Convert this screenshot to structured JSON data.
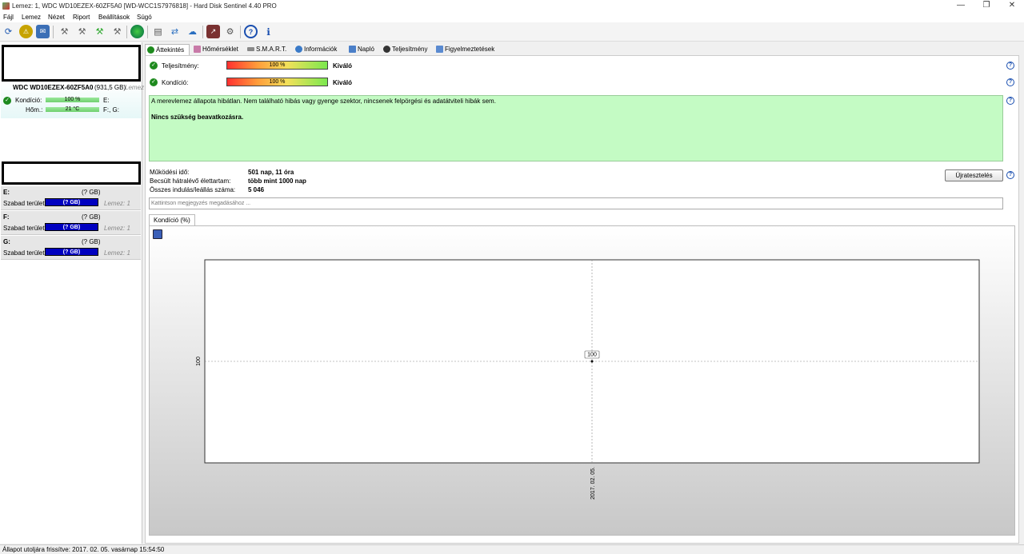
{
  "window": {
    "title": "Lemez: 1, WDC WD10EZEX-60ZF5A0 [WD-WCC1S7976818]  -  Hard Disk Sentinel 4.40 PRO"
  },
  "menu": [
    "Fájl",
    "Lemez",
    "Nézet",
    "Riport",
    "Beállítások",
    "Súgó"
  ],
  "toolbar_icons": [
    "refresh-icon",
    "disk-check-icon",
    "mail-icon",
    "tool-icon",
    "tool-icon",
    "tool-icon",
    "tool-icon",
    "globe-icon",
    "document-icon",
    "sync-icon",
    "network-icon",
    "chart-icon",
    "settings-icon",
    "help-icon",
    "info-icon"
  ],
  "left": {
    "disk_name": "WDC WD10EZEX-60ZF5A0",
    "disk_size": "(931,5 GB)",
    "disk_suffix": "Lemez",
    "condition_label": "Kondíció:",
    "condition_value": "100 %",
    "condition_drives": "E:",
    "temp_label": "Hőm.:",
    "temp_value": "21 °C",
    "temp_drives": "F:, G:",
    "volumes": [
      {
        "letter": "E:",
        "size": "(? GB)",
        "free_label": "Szabad terület",
        "free": "(? GB)",
        "disk": "Lemez: 1"
      },
      {
        "letter": "F:",
        "size": "(? GB)",
        "free_label": "Szabad terület",
        "free": "(? GB)",
        "disk": "Lemez: 1"
      },
      {
        "letter": "G:",
        "size": "(? GB)",
        "free_label": "Szabad terület",
        "free": "(? GB)",
        "disk": "Lemez: 1"
      }
    ]
  },
  "tabs": [
    "Áttekintés",
    "Hőmérséklet",
    "S.M.A.R.T.",
    "Információk",
    "Napló",
    "Teljesítmény",
    "Figyelmeztetések"
  ],
  "overview": {
    "performance_label": "Teljesítmény:",
    "performance_value": "100 %",
    "performance_rating": "Kiváló",
    "health_label": "Kondíció:",
    "health_value": "100 %",
    "health_rating": "Kiváló",
    "message": "A merevlemez állapota hibátlan. Nem található hibás vagy gyenge szektor, nincsenek felpörgési és adatátviteli hibák sem.",
    "recommendation": "Nincs szükség beavatkozásra.",
    "uptime_label": "Működési idő:",
    "uptime_value": "501 nap, 11 óra",
    "lifetime_label": "Becsült hátralévő élettartam:",
    "lifetime_value": "több mint 1000 nap",
    "startstop_label": "Összes indulás/leállás száma:",
    "startstop_value": "5 046",
    "retest_button": "Újratesztelés",
    "note_placeholder": "Kattintson megjegyzés megadásához ...",
    "chart_tab": "Kondíció  (%)"
  },
  "chart_data": {
    "type": "line",
    "x": [
      "2017. 02. 05."
    ],
    "series": [
      {
        "values": [
          100
        ]
      }
    ],
    "yticks": [
      "100"
    ],
    "point_label": "100"
  },
  "status": "Állapot utoljára frissítve: 2017. 02. 05. vasárnap 15:54:50"
}
